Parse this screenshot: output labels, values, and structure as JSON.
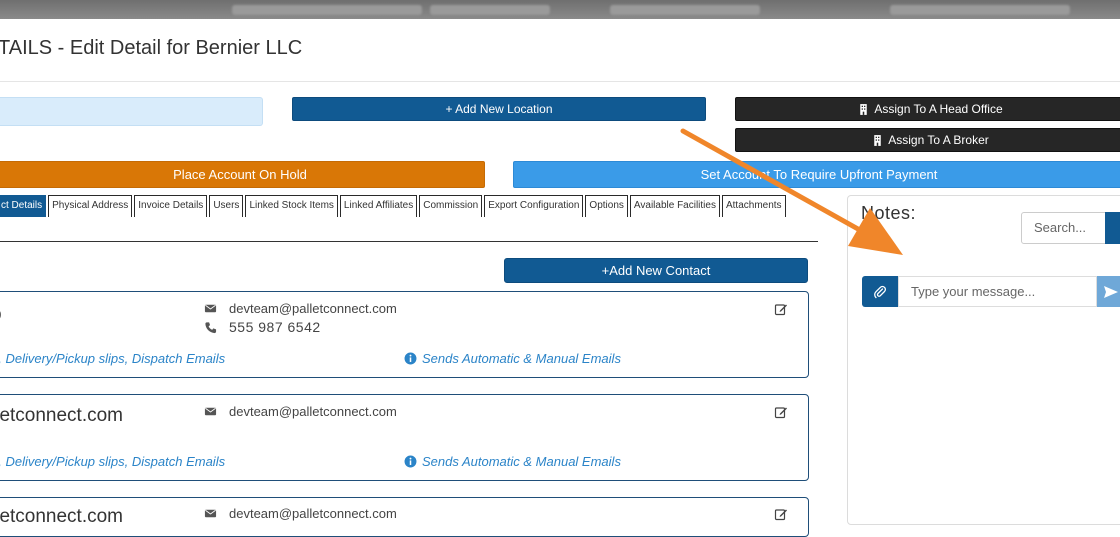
{
  "modal": {
    "title": "TAILS - Edit Detail for Bernier LLC"
  },
  "actions": {
    "add_location": "+ Add New Location",
    "assign_head_office": "Assign To A Head Office",
    "assign_broker": "Assign To A Broker",
    "place_on_hold": "Place Account On Hold",
    "require_upfront": "Set Account To Require Upfront Payment"
  },
  "tabs": [
    {
      "label": "ct Details",
      "active": true
    },
    {
      "label": "Physical Address"
    },
    {
      "label": "Invoice Details"
    },
    {
      "label": "Users"
    },
    {
      "label": "Linked Stock Items"
    },
    {
      "label": "Linked Affiliates"
    },
    {
      "label": "Commission"
    },
    {
      "label": "Export Configuration"
    },
    {
      "label": "Options"
    },
    {
      "label": "Available Facilities"
    },
    {
      "label": "Attachments"
    }
  ],
  "contacts": {
    "add_button": "+Add New Contact",
    "items": [
      {
        "name": "o",
        "email": "devteam@palletconnect.com",
        "phone": "555 987 6542",
        "roles": "n, Delivery/Pickup slips, Dispatch Emails",
        "email_note": "Sends Automatic & Manual Emails"
      },
      {
        "name": "lletconnect.com",
        "email": "devteam@palletconnect.com",
        "roles": "n, Delivery/Pickup slips, Dispatch Emails",
        "email_note": "Sends Automatic & Manual Emails"
      },
      {
        "name": "lletconnect.com",
        "email": "devteam@palletconnect.com"
      }
    ]
  },
  "notes": {
    "title": "Notes:",
    "search_placeholder": "Search...",
    "message_placeholder": "Type your message..."
  },
  "colors": {
    "navy": "#115a93",
    "orange": "#d97706",
    "sky": "#3a9be8",
    "black": "#262626",
    "annotation_arrow": "#f0862a"
  }
}
